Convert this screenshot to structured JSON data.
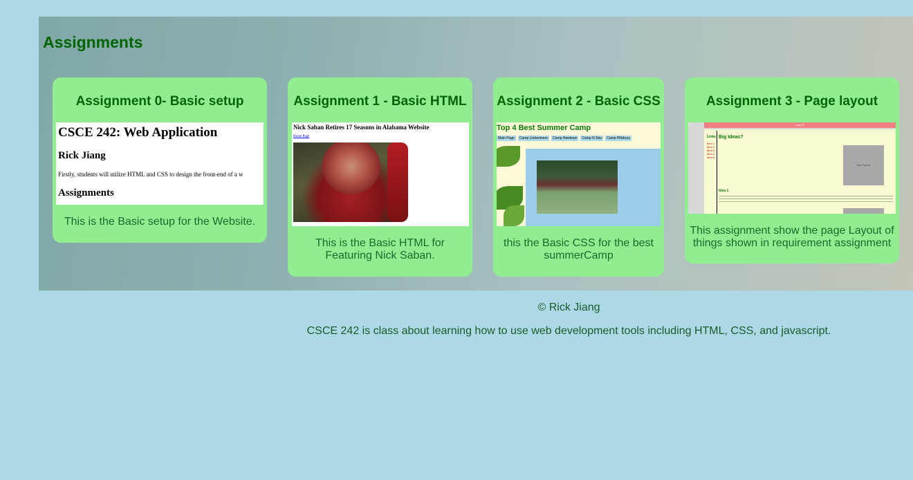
{
  "section": {
    "title": "Assignments"
  },
  "cards": [
    {
      "title": "Assignment 0- Basic setup",
      "description": "This is the Basic setup for the Website.",
      "thumbnail": {
        "heading": "CSCE 242: Web Application",
        "name": "Rick Jiang",
        "text": "Firstly, students will utilize HTML and CSS to design the front-end of a w",
        "subheading": "Assignments"
      }
    },
    {
      "title": "Assignment 1 - Basic HTML",
      "description": "This is the Basic HTML for Featuring Nick Saban.",
      "thumbnail": {
        "heading": "Nick Saban Retires 17 Seasons in Alabama Website",
        "link": "Home Page"
      }
    },
    {
      "title": "Assignment 2 - Basic CSS",
      "description": "this the Basic CSS for the best summerCamp",
      "thumbnail": {
        "heading": "Top 4 Best Summer Camp",
        "nav": [
          "Main Page",
          "Camp Lindenmere",
          "Camp Hawkeye",
          "Camp N Star",
          "Camp Pillsbury"
        ]
      }
    },
    {
      "title": "Assignment 3 - Page layout",
      "description": "This assignment show the page Layout of things shown in requirement assignment",
      "thumbnail": {
        "header": "Logo R",
        "links_label": "Links",
        "links": [
          "Item 1",
          "Item 2",
          "Item 3",
          "Item 4",
          "Item 5"
        ],
        "heading": "Big Ideas?",
        "image_label": "Not Found",
        "idea": "Idea 1"
      }
    }
  ],
  "footer": {
    "copyright": "© Rick Jiang",
    "description": "CSCE 242 is class about learning how to use web development tools including HTML, CSS, and javascript."
  },
  "colors": {
    "page_background": "#add8e6",
    "card_background": "#90ee90",
    "heading_text": "#006400"
  }
}
